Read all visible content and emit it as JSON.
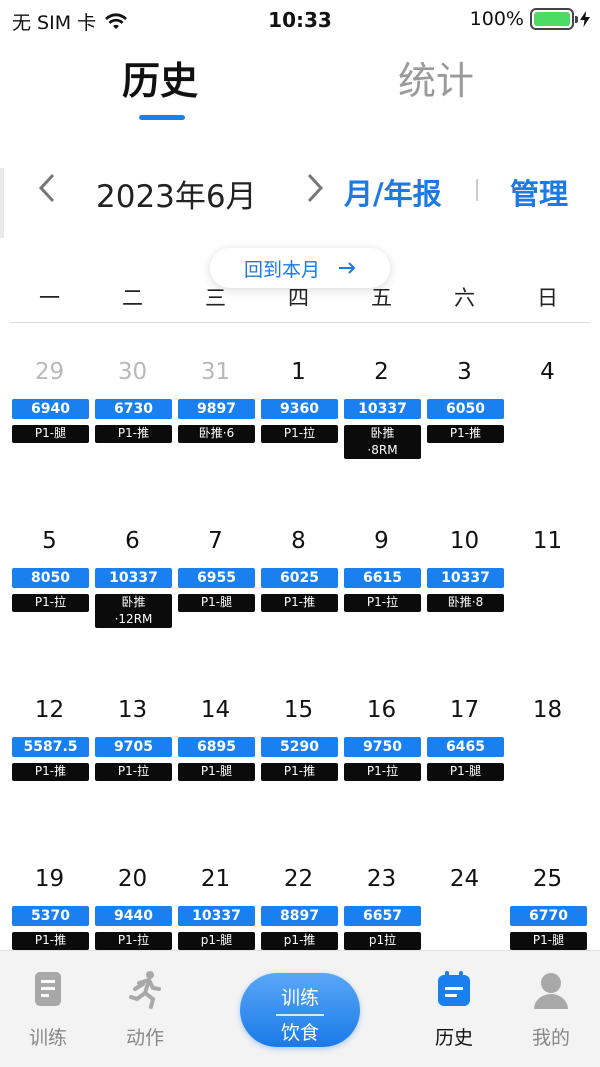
{
  "status": {
    "carrier": "无 SIM 卡",
    "time": "10:33",
    "battery": "100%"
  },
  "tabs": [
    {
      "label": "历史"
    },
    {
      "label": "统计"
    }
  ],
  "header": {
    "month": "2023年6月",
    "report": "月/年报",
    "manage": "管理",
    "back_to_month": "回到本月",
    "prev": "<",
    "next": ">"
  },
  "weekdays": [
    "一",
    "二",
    "三",
    "四",
    "五",
    "六",
    "日"
  ],
  "calendar": {
    "weeks": [
      [
        {
          "day": "29",
          "muted": true,
          "volume": "6940",
          "tag": "P1-腿"
        },
        {
          "day": "30",
          "muted": true,
          "volume": "6730",
          "tag": "P1-推"
        },
        {
          "day": "31",
          "muted": true,
          "volume": "9897",
          "tag": "卧推·6"
        },
        {
          "day": "1",
          "volume": "9360",
          "tag": "P1-拉"
        },
        {
          "day": "2",
          "volume": "10337",
          "tag": "卧推\n·8RM"
        },
        {
          "day": "3",
          "volume": "6050",
          "tag": "P1-推"
        },
        {
          "day": "4"
        }
      ],
      [
        {
          "day": "5",
          "volume": "8050",
          "tag": "P1-拉"
        },
        {
          "day": "6",
          "volume": "10337",
          "tag": "卧推\n·12RM"
        },
        {
          "day": "7",
          "volume": "6955",
          "tag": "P1-腿"
        },
        {
          "day": "8",
          "volume": "6025",
          "tag": "P1-推"
        },
        {
          "day": "9",
          "volume": "6615",
          "tag": "P1-拉"
        },
        {
          "day": "10",
          "volume": "10337",
          "tag": "卧推·8"
        },
        {
          "day": "11"
        }
      ],
      [
        {
          "day": "12",
          "volume": "5587.5",
          "tag": "P1-推"
        },
        {
          "day": "13",
          "volume": "9705",
          "tag": "P1-拉"
        },
        {
          "day": "14",
          "volume": "6895",
          "tag": "P1-腿"
        },
        {
          "day": "15",
          "volume": "5290",
          "tag": "P1-推"
        },
        {
          "day": "16",
          "volume": "9750",
          "tag": "P1-拉"
        },
        {
          "day": "17",
          "volume": "6465",
          "tag": "P1-腿"
        },
        {
          "day": "18"
        }
      ],
      [
        {
          "day": "19",
          "volume": "5370",
          "tag": "P1-推"
        },
        {
          "day": "20",
          "volume": "9440",
          "tag": "P1-拉"
        },
        {
          "day": "21",
          "volume": "10337",
          "tag": "p1-腿"
        },
        {
          "day": "22",
          "volume": "8897",
          "tag": "p1-推"
        },
        {
          "day": "23",
          "volume": "6657",
          "tag": "p1拉"
        },
        {
          "day": "24"
        },
        {
          "day": "25",
          "volume": "6770",
          "tag": "P1-腿"
        }
      ]
    ]
  },
  "bottom_nav": {
    "items": [
      {
        "label": "训练",
        "icon": "document-icon"
      },
      {
        "label": "动作",
        "icon": "runner-icon"
      },
      {
        "label": "历史",
        "icon": "calendar-icon",
        "active": true
      },
      {
        "label": "我的",
        "icon": "user-icon"
      }
    ],
    "center": {
      "line1": "训练",
      "line2": "饮食"
    }
  },
  "colors": {
    "accent": "#1a80f0",
    "tag_bg": "#0b0b0b",
    "muted": "#b9b9b9"
  }
}
